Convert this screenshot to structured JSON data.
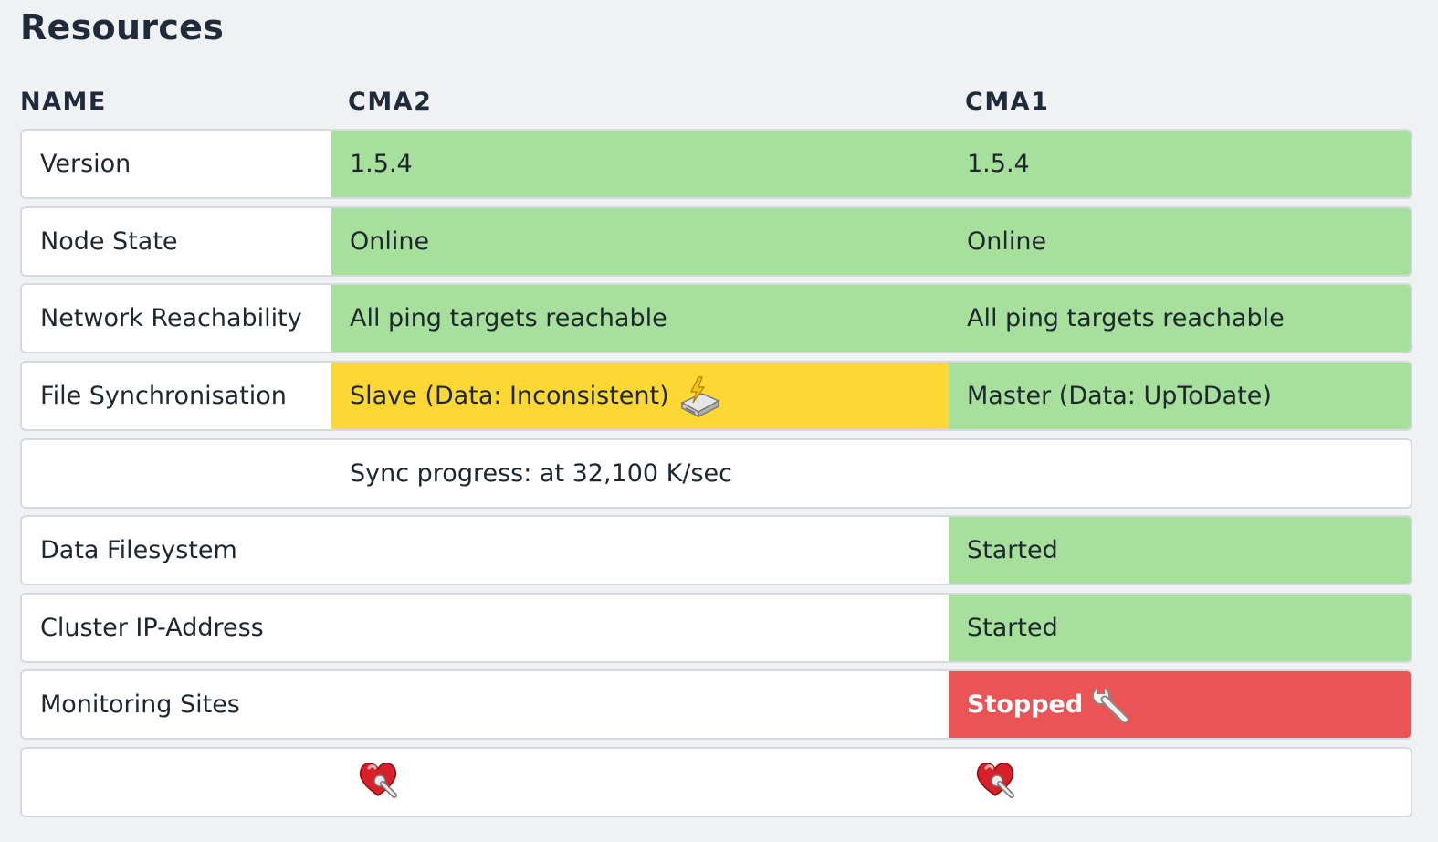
{
  "title": "Resources",
  "headers": {
    "name": "NAME",
    "cma2": "CMA2",
    "cma1": "CMA1"
  },
  "rows": {
    "version": {
      "label": "Version",
      "cma2": "1.5.4",
      "cma1": "1.5.4"
    },
    "node_state": {
      "label": "Node State",
      "cma2": "Online",
      "cma1": "Online"
    },
    "network": {
      "label": "Network Reachability",
      "cma2": "All ping targets reachable",
      "cma1": "All ping targets reachable"
    },
    "file_sync": {
      "label": "File Synchronisation",
      "cma2": "Slave (Data: Inconsistent)",
      "cma1": "Master (Data: UpToDate)",
      "cma2_icon": "disk-sync-icon"
    },
    "sync_progress": {
      "text": "Sync progress: at 32,100 K/sec"
    },
    "data_fs": {
      "label": "Data Filesystem",
      "cma2": "",
      "cma1": "Started"
    },
    "cluster_ip": {
      "label": "Cluster IP-Address",
      "cma2": "",
      "cma1": "Started"
    },
    "monitoring_sites": {
      "label": "Monitoring Sites",
      "cma2": "",
      "cma1": "Stopped",
      "cma1_icon": "wrench-icon"
    },
    "actions": {
      "cma2_icon": "heart-wrench-icon",
      "cma1_icon": "heart-wrench-icon"
    }
  },
  "colors": {
    "ok": "#a7e09c",
    "warn": "#fdd835",
    "crit": "#ea5455"
  }
}
